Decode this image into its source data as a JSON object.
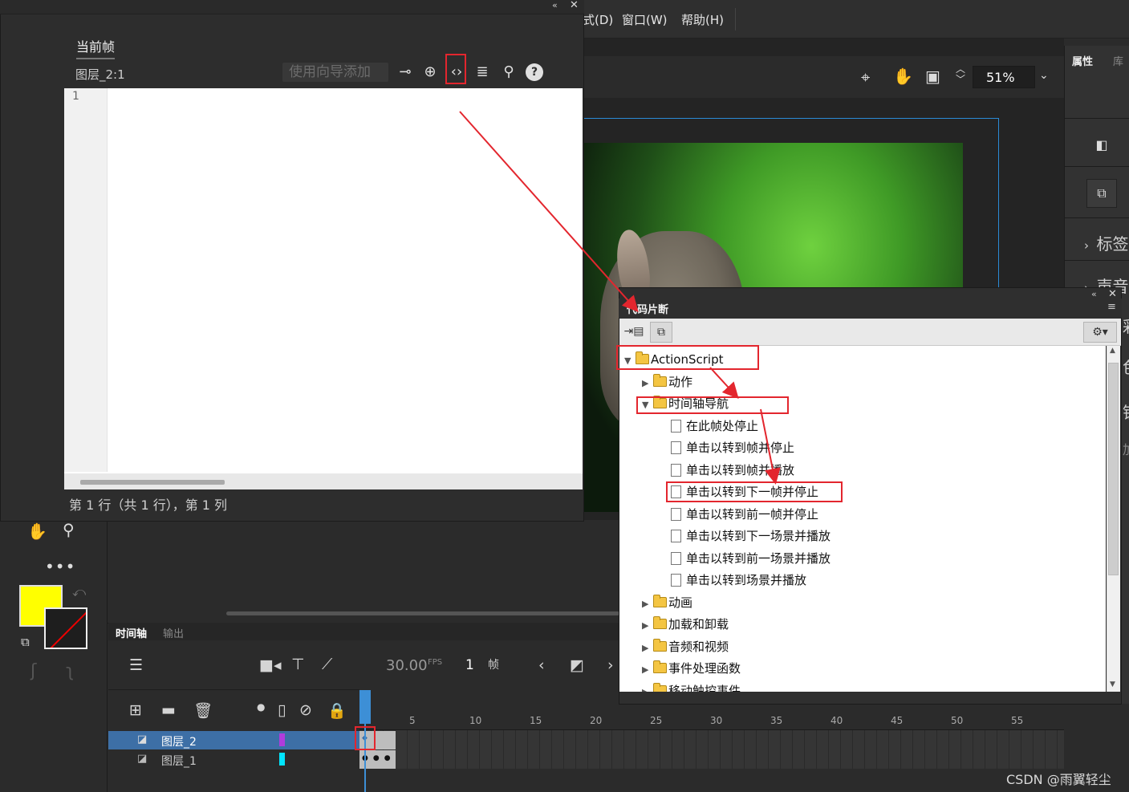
{
  "menu": {
    "items": [
      "式(D)",
      "窗口(W)",
      "帮助(H)"
    ]
  },
  "stage": {
    "zoom": "51%"
  },
  "properties": {
    "tab_props": "属性",
    "tab_library": "库",
    "row_label": "标签",
    "row_sound": "声音",
    "row_partial_1": "彩",
    "row_partial_2": "色",
    "row_partial_3": "锁",
    "row_partial_4": "加"
  },
  "actions": {
    "tab": "当前帧",
    "layer": "图层_2:1",
    "wizard_button": "使用向导添加",
    "line_number": "1",
    "status": "第 1 行（共 1 行），第 1 列"
  },
  "snippets": {
    "title": "代码片断",
    "root": "ActionScript",
    "folders_top": [
      "动作",
      "时间轴导航"
    ],
    "items": [
      "在此帧处停止",
      "单击以转到帧并停止",
      "单击以转到帧并播放",
      "单击以转到下一帧并停止",
      "单击以转到前一帧并停止",
      "单击以转到下一场景并播放",
      "单击以转到前一场景并播放",
      "单击以转到场景并播放"
    ],
    "folders_bottom": [
      "动画",
      "加载和卸载",
      "音频和视频",
      "事件处理函数",
      "移动触控事件"
    ]
  },
  "timeline": {
    "tab_timeline": "时间轴",
    "tab_output": "输出",
    "fps": "30.00",
    "fps_unit": "FPS",
    "frame": "1",
    "frame_unit": "帧",
    "ruler": [
      "5",
      "10",
      "15",
      "20",
      "25",
      "30",
      "35",
      "40",
      "45",
      "50",
      "55"
    ],
    "layers": [
      {
        "name": "图层_2",
        "color": "#b03cdc"
      },
      {
        "name": "图层_1",
        "color": "#00e5ff"
      }
    ]
  },
  "colors": {
    "fill": "#ffff00",
    "annotation": "#e3262e",
    "selection": "#3d6fa6"
  },
  "watermark": "CSDN @雨翼轻尘"
}
